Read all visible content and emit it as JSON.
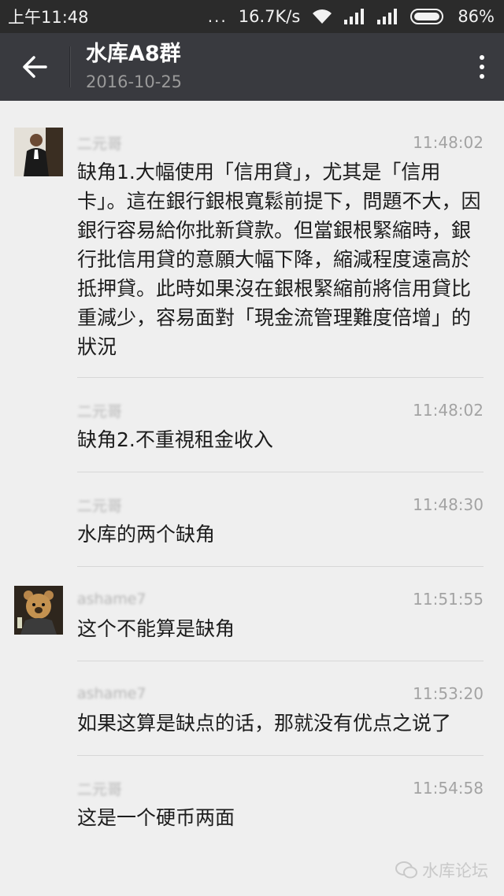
{
  "status_bar": {
    "time": "上午11:48",
    "dots": "...",
    "speed": "16.7K/s",
    "battery": "86%"
  },
  "header": {
    "title": "水库A8群",
    "subtitle": "2016-10-25",
    "back_icon": "arrow-left-icon",
    "more_icon": "more-vertical-icon"
  },
  "messages": [
    {
      "sender": "二元哥",
      "time": "11:48:02",
      "text": "缺角1.大幅使用「信用貸」，尤其是「信用卡」。這在銀行銀根寬鬆前提下，問題不大，因銀行容易給你批新貸款。但當銀根緊縮時，銀行批信用貸的意願大幅下降，縮減程度遠高於抵押貸。此時如果沒在銀根緊縮前將信用貸比重減少，容易面對「現金流管理難度倍增」的狀況",
      "avatar": "person-avatar"
    },
    {
      "sender": "二元哥",
      "time": "11:48:02",
      "text": "缺角2.不重視租金收入"
    },
    {
      "sender": "二元哥",
      "time": "11:48:30",
      "text": "水库的两个缺角"
    },
    {
      "sender": "ashame7",
      "time": "11:51:55",
      "text": "这个不能算是缺角",
      "avatar": "bear-avatar"
    },
    {
      "sender": "ashame7",
      "time": "11:53:20",
      "text": "如果这算是缺点的话，那就没有优点之说了"
    },
    {
      "sender": "二元哥",
      "time": "11:54:58",
      "text": "这是一个硬币两面"
    }
  ],
  "watermark": "水库论坛"
}
